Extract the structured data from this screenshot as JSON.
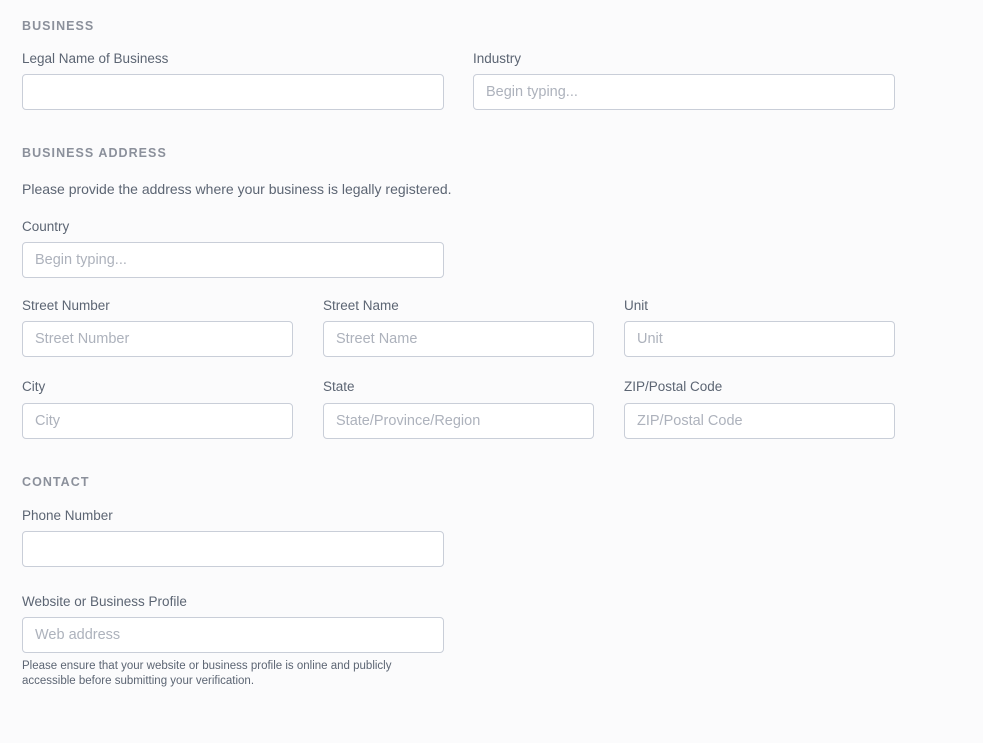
{
  "sections": {
    "business": {
      "title": "BUSINESS",
      "fields": {
        "legal_name": {
          "label": "Legal Name of Business",
          "value": "",
          "placeholder": ""
        },
        "industry": {
          "label": "Industry",
          "value": "",
          "placeholder": "Begin typing..."
        }
      }
    },
    "business_address": {
      "title": "BUSINESS ADDRESS",
      "description": "Please provide the address where your business is legally registered.",
      "fields": {
        "country": {
          "label": "Country",
          "value": "",
          "placeholder": "Begin typing..."
        },
        "street_number": {
          "label": "Street Number",
          "value": "",
          "placeholder": "Street Number"
        },
        "street_name": {
          "label": "Street Name",
          "value": "",
          "placeholder": "Street Name"
        },
        "unit": {
          "label": "Unit",
          "value": "",
          "placeholder": "Unit"
        },
        "city": {
          "label": "City",
          "value": "",
          "placeholder": "City"
        },
        "state": {
          "label": "State",
          "value": "",
          "placeholder": "State/Province/Region"
        },
        "zip": {
          "label": "ZIP/Postal Code",
          "value": "",
          "placeholder": "ZIP/Postal Code"
        }
      }
    },
    "contact": {
      "title": "CONTACT",
      "fields": {
        "phone": {
          "label": "Phone Number",
          "value": "",
          "placeholder": ""
        },
        "website": {
          "label": "Website or Business Profile",
          "value": "",
          "placeholder": "Web address"
        }
      },
      "website_note": "Please ensure that your website or business profile is online and publicly accessible before submitting your verification."
    }
  },
  "colors": {
    "page_background": "#fbfbfc",
    "input_border": "#c9ced8",
    "input_background": "#ffffff",
    "label_text": "#5c6573",
    "section_title_text": "#8b909b",
    "placeholder_text": "#adb2bc"
  }
}
